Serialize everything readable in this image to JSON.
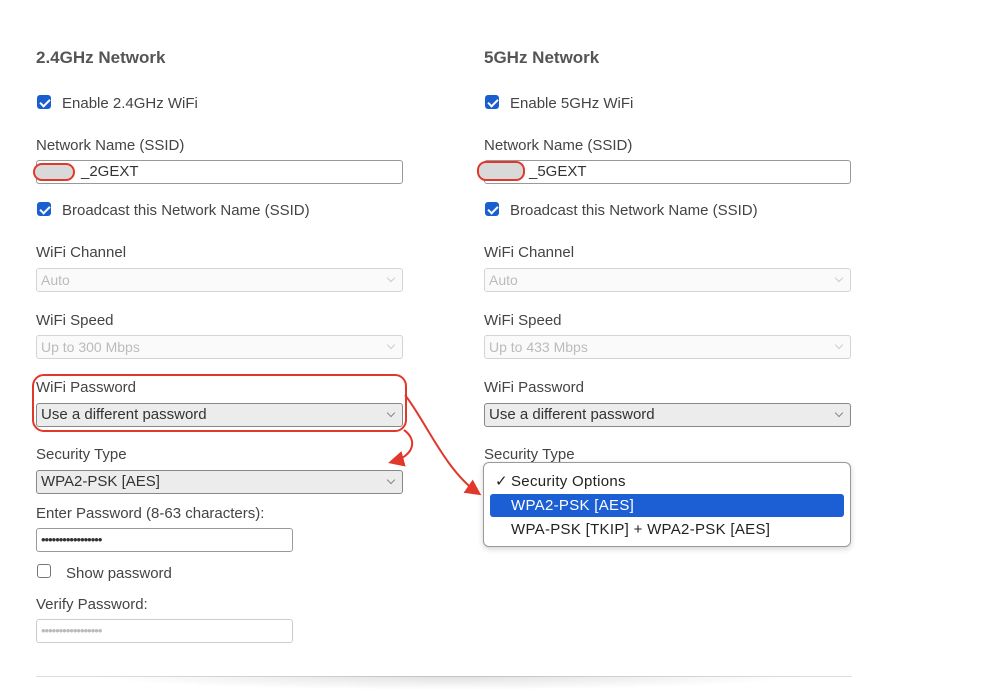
{
  "left": {
    "title": "2.4GHz Network",
    "enable_label": "Enable 2.4GHz WiFi",
    "ssid_label": "Network Name (SSID)",
    "ssid_value": "_2GEXT",
    "broadcast_label": "Broadcast this Network Name (SSID)",
    "channel_label": "WiFi Channel",
    "channel_value": "Auto",
    "speed_label": "WiFi Speed",
    "speed_value": "Up to 300 Mbps",
    "password_label": "WiFi Password",
    "password_value": "Use a different password",
    "security_label": "Security Type",
    "security_value": "WPA2-PSK [AES]",
    "enter_password_label": "Enter Password (8-63 characters):",
    "enter_password_value": "•••••••••••••••••",
    "show_password_label": "Show password",
    "verify_label": "Verify Password:",
    "verify_value": "•••••••••••••••••"
  },
  "right": {
    "title": "5GHz Network",
    "enable_label": "Enable 5GHz WiFi",
    "ssid_label": "Network Name (SSID)",
    "ssid_value": "_5GEXT",
    "broadcast_label": "Broadcast this Network Name (SSID)",
    "channel_label": "WiFi Channel",
    "channel_value": "Auto",
    "speed_label": "WiFi Speed",
    "speed_value": "Up to 433 Mbps",
    "password_label": "WiFi Password",
    "password_value": "Use a different password",
    "security_label": "Security Type",
    "dropdown": {
      "header_check": "✓",
      "header": "Security Options",
      "options": [
        "WPA2-PSK [AES]",
        "WPA-PSK [TKIP] + WPA2-PSK [AES]"
      ]
    }
  },
  "colors": {
    "accent": "#1c5fd5",
    "annotation": "#e0382a"
  }
}
